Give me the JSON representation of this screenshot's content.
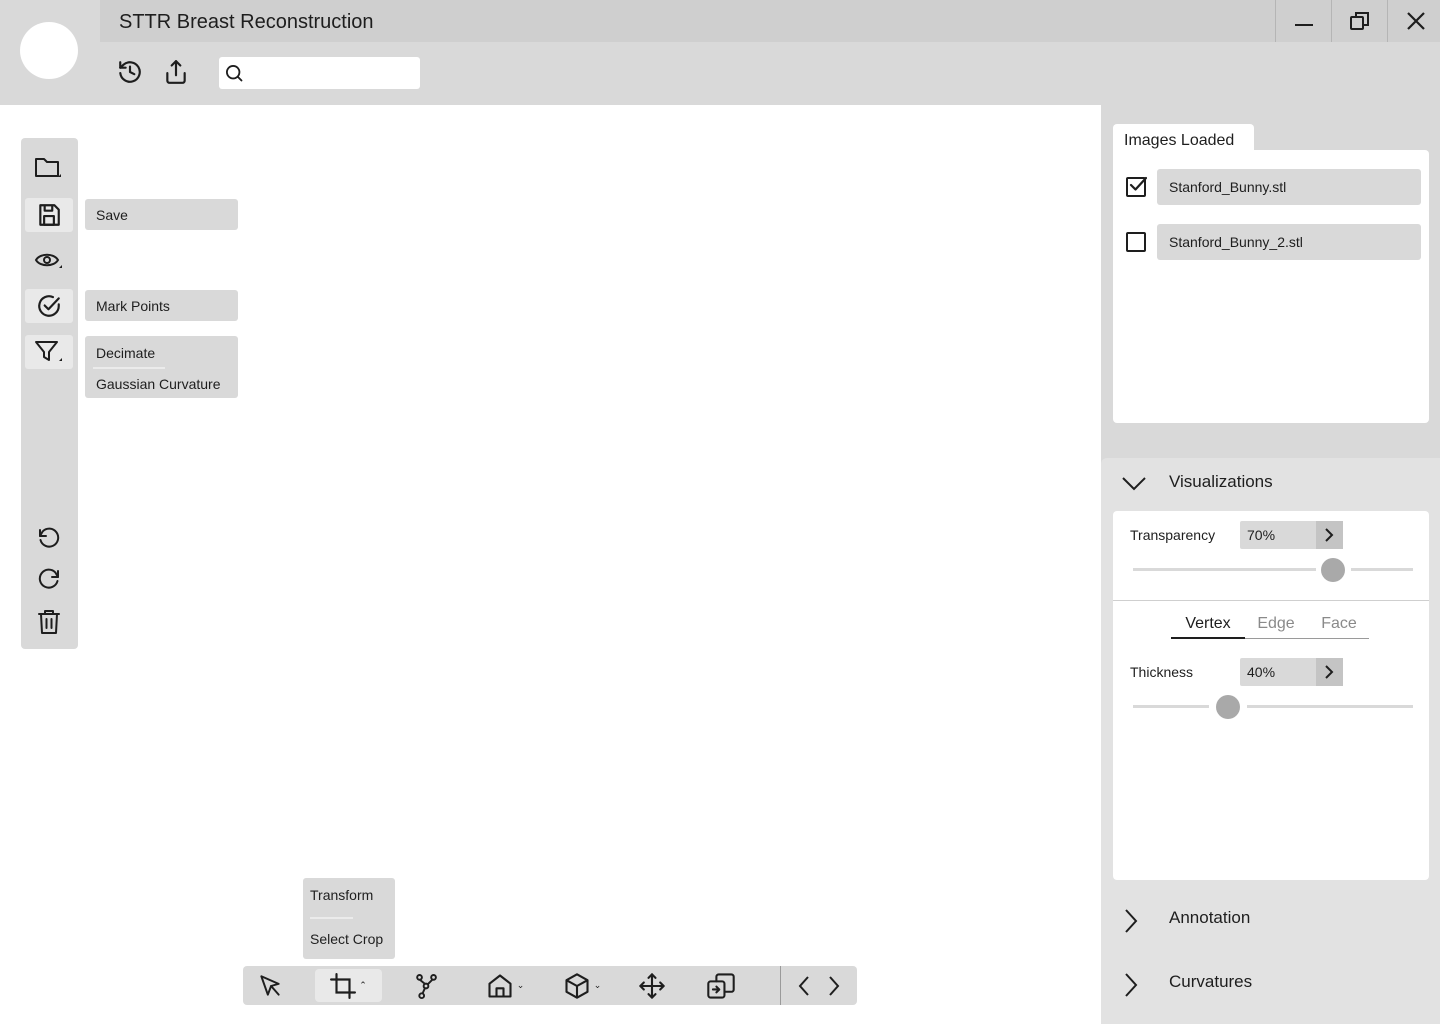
{
  "window": {
    "title": "STTR Breast Reconstruction",
    "controls": [
      "minimize-icon",
      "restore-icon",
      "close-icon"
    ]
  },
  "toolbar": {
    "icons": [
      "history-icon",
      "share-icon"
    ],
    "search": {
      "value": "",
      "placeholder": ""
    }
  },
  "left_toolbar": {
    "items": [
      {
        "name": "open-folder",
        "icon": "folder-icon",
        "has_submenu": true
      },
      {
        "name": "save",
        "icon": "save-icon",
        "active": true,
        "flyout": [
          "Save"
        ]
      },
      {
        "name": "view",
        "icon": "eye-icon",
        "has_submenu": true
      },
      {
        "name": "mark",
        "icon": "check-circle-icon",
        "active": true,
        "flyout": [
          "Mark Points"
        ]
      },
      {
        "name": "filter",
        "icon": "filter-icon",
        "active": true,
        "has_submenu": true,
        "flyout": [
          "Decimate",
          "Gaussian Curvature"
        ]
      }
    ],
    "bottom_icons": [
      "undo-icon",
      "redo-icon",
      "trash-icon"
    ],
    "save_flyout": "Save",
    "mark_flyout": "Mark Points",
    "filter_flyout": [
      "Decimate",
      "Gaussian Curvature"
    ]
  },
  "images_panel": {
    "tab_label": "Images Loaded",
    "files": [
      {
        "name": "Stanford_Bunny.stl",
        "checked": true
      },
      {
        "name": "Stanford_Bunny_2.stl",
        "checked": false
      }
    ]
  },
  "visualizations": {
    "label": "Visualizations",
    "expanded": true,
    "transparency": {
      "label": "Transparency",
      "value_text": "70%",
      "value": 0.7
    },
    "mode_tabs": [
      "Vertex",
      "Edge",
      "Face"
    ],
    "active_mode": "Vertex",
    "thickness": {
      "label": "Thickness",
      "value_text": "40%",
      "value": 0.4
    }
  },
  "annotation": {
    "label": "Annotation",
    "expanded": false
  },
  "curvatures": {
    "label": "Curvatures",
    "expanded": false
  },
  "bottom_toolbar": {
    "tools": [
      "select-arrow-icon",
      "crop-icon",
      "spline-icon",
      "home-icon",
      "cube-icon",
      "move-icon",
      "transfer-icon",
      "chevron-left-icon",
      "chevron-right-icon"
    ],
    "active_tool": "crop-icon",
    "crop_flyout": [
      "Transform",
      "Select Crop"
    ]
  },
  "colors": {
    "panel_gray": "#d9d9d9",
    "header_gray": "#cfcfcf",
    "knob": "#a9a9a9",
    "text": "#1e1e1e"
  }
}
